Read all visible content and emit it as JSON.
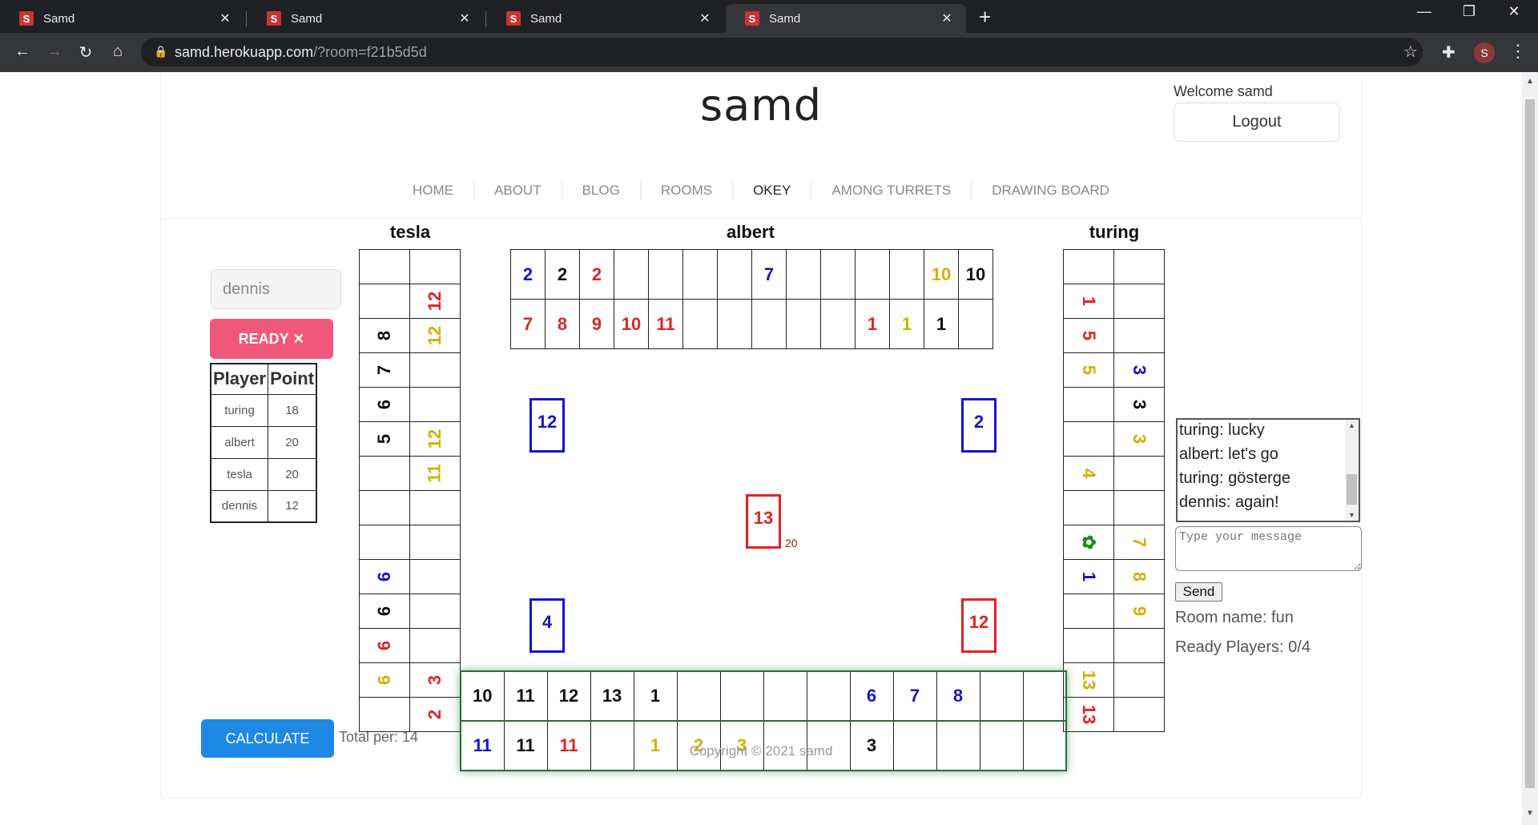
{
  "colors": {
    "red": "#e02424",
    "blue": "#1515c8",
    "yellow": "#d4b000",
    "black": "#111111",
    "green": "#1a8a1a"
  },
  "browser": {
    "tabs": [
      {
        "title": "Samd",
        "close": "✕"
      },
      {
        "title": "Samd",
        "close": "✕"
      },
      {
        "title": "Samd",
        "close": "✕"
      },
      {
        "title": "Samd",
        "close": "✕"
      }
    ],
    "new_tab": "+",
    "window_controls": {
      "minimize": "—",
      "restore": "❐",
      "close": "✕"
    },
    "url_host": "samd.herokuapp.com",
    "url_path": "/?room=f21b5d5d",
    "profile_initial": "S"
  },
  "site": {
    "title": "samd",
    "welcome": "Welcome samd",
    "logout": "Logout",
    "nav": [
      "HOME",
      "ABOUT",
      "BLOG",
      "ROOMS",
      "OKEY",
      "AMONG TURRETS",
      "DRAWING BOARD"
    ],
    "active_nav": "OKEY",
    "copyright": "Copyright © 2021 samd"
  },
  "game": {
    "players": {
      "left": "tesla",
      "top": "albert",
      "right": "turing"
    },
    "name_input_value": "dennis",
    "ready_button": "READY ✕",
    "score_headers": [
      "Player",
      "Point"
    ],
    "scores": [
      {
        "player": "turing",
        "point": "18"
      },
      {
        "player": "albert",
        "point": "20"
      },
      {
        "player": "tesla",
        "point": "20"
      },
      {
        "player": "dennis",
        "point": "12"
      }
    ],
    "calculate_button": "CALCULATE",
    "total_per": "Total per: 14",
    "tesla_grid": [
      [
        null,
        null
      ],
      [
        null,
        {
          "v": "12",
          "c": "red"
        }
      ],
      [
        {
          "v": "8",
          "c": "black"
        },
        {
          "v": "12",
          "c": "yellow"
        }
      ],
      [
        {
          "v": "7",
          "c": "black"
        },
        null
      ],
      [
        {
          "v": "6",
          "c": "black"
        },
        null
      ],
      [
        {
          "v": "5",
          "c": "black"
        },
        {
          "v": "12",
          "c": "yellow"
        }
      ],
      [
        null,
        {
          "v": "11",
          "c": "yellow"
        }
      ],
      [
        null,
        null
      ],
      [
        null,
        null
      ],
      [
        {
          "v": "6",
          "c": "blue"
        },
        null
      ],
      [
        {
          "v": "6",
          "c": "black"
        },
        null
      ],
      [
        {
          "v": "6",
          "c": "red"
        },
        null
      ],
      [
        {
          "v": "6",
          "c": "yellow"
        },
        {
          "v": "3",
          "c": "red"
        }
      ],
      [
        null,
        {
          "v": "2",
          "c": "red"
        }
      ]
    ],
    "turing_grid": [
      [
        null,
        null
      ],
      [
        {
          "v": "1",
          "c": "red"
        },
        null
      ],
      [
        {
          "v": "5",
          "c": "red"
        },
        null
      ],
      [
        {
          "v": "5",
          "c": "yellow"
        },
        {
          "v": "3",
          "c": "blue"
        }
      ],
      [
        null,
        {
          "v": "3",
          "c": "black"
        }
      ],
      [
        null,
        {
          "v": "3",
          "c": "yellow"
        }
      ],
      [
        {
          "v": "4",
          "c": "yellow"
        },
        null
      ],
      [
        null,
        null
      ],
      [
        {
          "v": "✿",
          "c": "green"
        },
        {
          "v": "7",
          "c": "yellow"
        }
      ],
      [
        {
          "v": "1",
          "c": "blue"
        },
        {
          "v": "8",
          "c": "yellow"
        }
      ],
      [
        null,
        {
          "v": "9",
          "c": "yellow"
        }
      ],
      [
        null,
        null
      ],
      [
        {
          "v": "13",
          "c": "yellow"
        },
        null
      ],
      [
        {
          "v": "13",
          "c": "red"
        },
        null
      ]
    ],
    "albert_grid": [
      [
        {
          "v": "2",
          "c": "blue"
        },
        {
          "v": "2",
          "c": "black"
        },
        {
          "v": "2",
          "c": "red"
        },
        null,
        null,
        null,
        null,
        {
          "v": "7",
          "c": "blue"
        },
        null,
        null,
        null,
        null,
        {
          "v": "10",
          "c": "yellow"
        },
        {
          "v": "10",
          "c": "black"
        }
      ],
      [
        {
          "v": "7",
          "c": "red"
        },
        {
          "v": "8",
          "c": "red"
        },
        {
          "v": "9",
          "c": "red"
        },
        {
          "v": "10",
          "c": "red"
        },
        {
          "v": "11",
          "c": "red"
        },
        null,
        null,
        null,
        null,
        null,
        {
          "v": "1",
          "c": "red"
        },
        {
          "v": "1",
          "c": "yellow"
        },
        {
          "v": "1",
          "c": "black"
        },
        null
      ]
    ],
    "rack": [
      [
        {
          "v": "10",
          "c": "black"
        },
        {
          "v": "11",
          "c": "black"
        },
        {
          "v": "12",
          "c": "black"
        },
        {
          "v": "13",
          "c": "black"
        },
        {
          "v": "1",
          "c": "black"
        },
        null,
        null,
        null,
        null,
        {
          "v": "6",
          "c": "blue"
        },
        {
          "v": "7",
          "c": "blue"
        },
        {
          "v": "8",
          "c": "blue"
        },
        null,
        null
      ],
      [
        {
          "v": "11",
          "c": "blue"
        },
        {
          "v": "11",
          "c": "black"
        },
        {
          "v": "11",
          "c": "red"
        },
        null,
        {
          "v": "1",
          "c": "yellow"
        },
        {
          "v": "2",
          "c": "yellow"
        },
        {
          "v": "3",
          "c": "yellow"
        },
        null,
        null,
        {
          "v": "3",
          "c": "black"
        },
        null,
        null,
        null,
        null
      ]
    ],
    "discards": [
      {
        "id": "top-left",
        "v": "12",
        "c": "blue"
      },
      {
        "id": "top-right",
        "v": "2",
        "c": "blue"
      },
      {
        "id": "bottom-left",
        "v": "4",
        "c": "blue"
      },
      {
        "id": "bottom-right",
        "v": "12",
        "c": "red"
      }
    ],
    "center_tile": {
      "v": "13",
      "c": "red"
    },
    "remaining": "20"
  },
  "chat": {
    "messages": [
      "turing: gösterge",
      "turing: lucky",
      "albert: let's go",
      "turing: gösterge",
      "dennis: again!"
    ],
    "placeholder": "Type your message",
    "send": "Send",
    "room_name": "Room name: fun",
    "ready_players": "Ready Players: 0/4"
  }
}
